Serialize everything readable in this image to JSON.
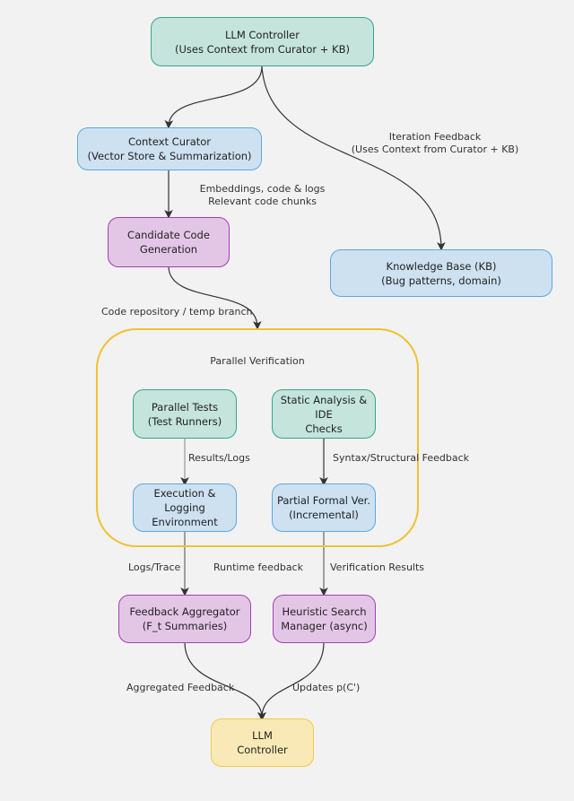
{
  "diagram": {
    "nodes": {
      "llm_top": {
        "line1": "LLM Controller",
        "line2": "(Uses Context from Curator + KB)"
      },
      "curator": {
        "line1": "Context Curator",
        "line2": "(Vector Store & Summarization)"
      },
      "candidate": {
        "line1": "Candidate Code",
        "line2": "Generation"
      },
      "kb": {
        "line1": "Knowledge Base (KB)",
        "line2": "(Bug patterns, domain)"
      },
      "parallel_tests": {
        "line1": "Parallel Tests",
        "line2": "(Test Runners)"
      },
      "static_analysis": {
        "line1": "Static Analysis & IDE",
        "line2": "Checks"
      },
      "execution": {
        "line1": "Execution & Logging",
        "line2": "Environment"
      },
      "formal": {
        "line1": "Partial Formal Ver.",
        "line2": "(Incremental)"
      },
      "aggregator": {
        "line1": "Feedback Aggregator",
        "line2": "(F_t Summaries)"
      },
      "heuristic": {
        "line1": "Heuristic Search",
        "line2": "Manager (async)"
      },
      "llm_bottom": {
        "line1": "LLM",
        "line2": "Controller"
      }
    },
    "group": {
      "title": "Parallel Verification"
    },
    "edge_labels": {
      "iteration_feedback": {
        "line1": "Iteration Feedback",
        "line2": "(Uses Context from Curator + KB)"
      },
      "embeddings": {
        "line1": "Embeddings, code & logs",
        "line2": "Relevant code chunks"
      },
      "code_repo": "Code repository / temp branch",
      "results_logs": "Results/Logs",
      "syntax_feedback": "Syntax/Structural Feedback",
      "logs_trace": "Logs/Trace",
      "runtime_feedback": "Runtime feedback",
      "verification_results": "Verification Results",
      "aggregated_feedback": "Aggregated Feedback",
      "updates": "Updates p(C')"
    },
    "colors": {
      "teal_fill": "#c4e4dc",
      "teal_border": "#35a68c",
      "blue_fill": "#cde1f1",
      "blue_border": "#5aa9e0",
      "purple_fill": "#e3c6e6",
      "purple_border": "#a43eb4",
      "yellow_fill": "#f8e9b6",
      "yellow_border": "#f2c94c",
      "group_border": "#f1c232",
      "edge": "#333333"
    }
  }
}
